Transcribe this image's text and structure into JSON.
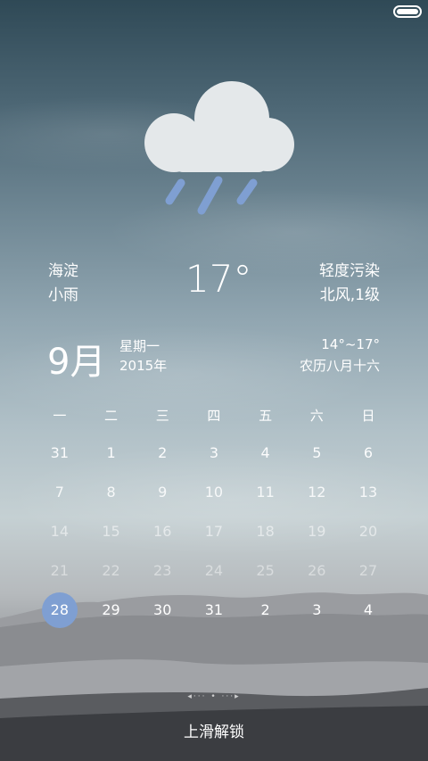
{
  "status_bar": {
    "battery_level": 1.0
  },
  "weather": {
    "icon": "rain-cloud-icon",
    "location": "海淀",
    "condition": "小雨",
    "temperature": "17°",
    "air_quality": "轻度污染",
    "wind": "北风,1级"
  },
  "date": {
    "month": "9月",
    "weekday": "星期一",
    "year": "2015年",
    "temp_range": "14°~17°",
    "lunar": "农历八月十六"
  },
  "calendar": {
    "weekday_headers": [
      "一",
      "二",
      "三",
      "四",
      "五",
      "六",
      "日"
    ],
    "weeks": [
      [
        "31",
        "1",
        "2",
        "3",
        "4",
        "5",
        "6"
      ],
      [
        "7",
        "8",
        "9",
        "10",
        "11",
        "12",
        "13"
      ],
      [
        "14",
        "15",
        "16",
        "17",
        "18",
        "19",
        "20"
      ],
      [
        "21",
        "22",
        "23",
        "24",
        "25",
        "26",
        "27"
      ],
      [
        "28",
        "29",
        "30",
        "31",
        "2",
        "3",
        "4"
      ]
    ],
    "today": "28"
  },
  "lock": {
    "swipe_indicator": "◂··· • ···▸",
    "unlock_label": "上滑解锁"
  },
  "colors": {
    "accent": "#7f9fd2",
    "cloud": "#e4e8ea"
  }
}
